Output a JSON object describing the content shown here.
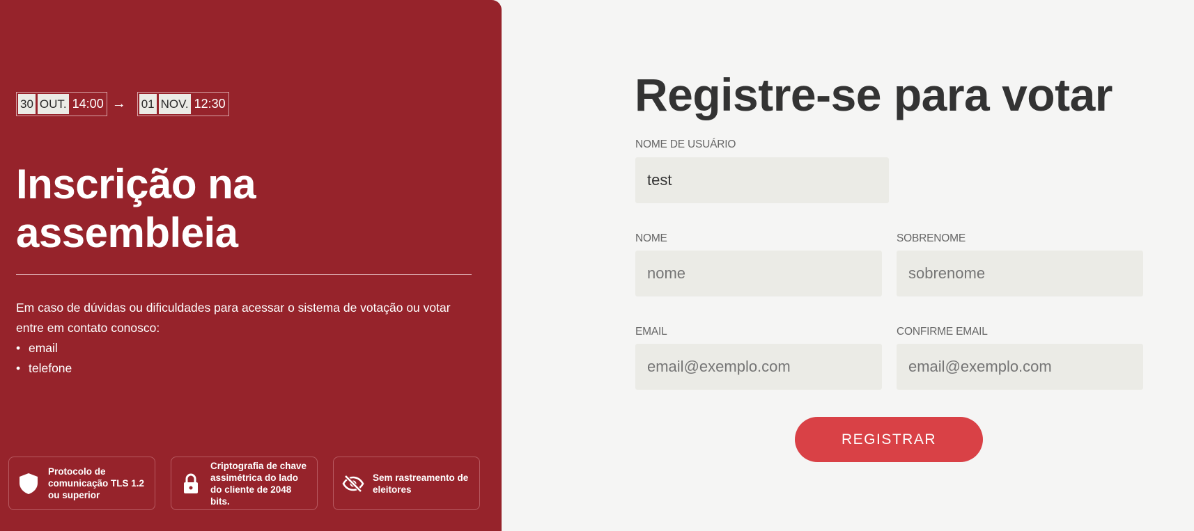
{
  "event": {
    "start": {
      "day": "30",
      "month": "OUT.",
      "time": "14:00"
    },
    "arrow": "→",
    "end": {
      "day": "01",
      "month": "NOV.",
      "time": "12:30"
    }
  },
  "left": {
    "title_line1": "Inscrição na",
    "title_line2": "assembleia",
    "help_text": "Em caso de dúvidas ou dificuldades para acessar o sistema de votação ou votar entre em contato conosco:",
    "contacts": [
      "email",
      "telefone"
    ],
    "badges": [
      {
        "icon": "shield-icon",
        "text": "Protocolo de comunicação TLS 1.2 ou superior"
      },
      {
        "icon": "lock-icon",
        "text": "Criptografia de chave assimétrica do lado do cliente de 2048 bits."
      },
      {
        "icon": "eye-off-icon",
        "text": "Sem rastreamento de eleitores"
      }
    ]
  },
  "form": {
    "title": "Registre-se para votar",
    "username": {
      "label": "NOME DE USUÁRIO",
      "value": "test"
    },
    "first_name": {
      "label": "NOME",
      "placeholder": "nome"
    },
    "last_name": {
      "label": "SOBRENOME",
      "placeholder": "sobrenome"
    },
    "email": {
      "label": "EMAIL",
      "placeholder": "email@exemplo.com"
    },
    "confirm_email": {
      "label": "CONFIRME EMAIL",
      "placeholder": "email@exemplo.com"
    },
    "submit_label": "REGISTRAR"
  },
  "colors": {
    "panel": "#96232b",
    "button": "#d94146",
    "input_bg": "#ebebe6",
    "page_bg": "#f5f5f4"
  }
}
